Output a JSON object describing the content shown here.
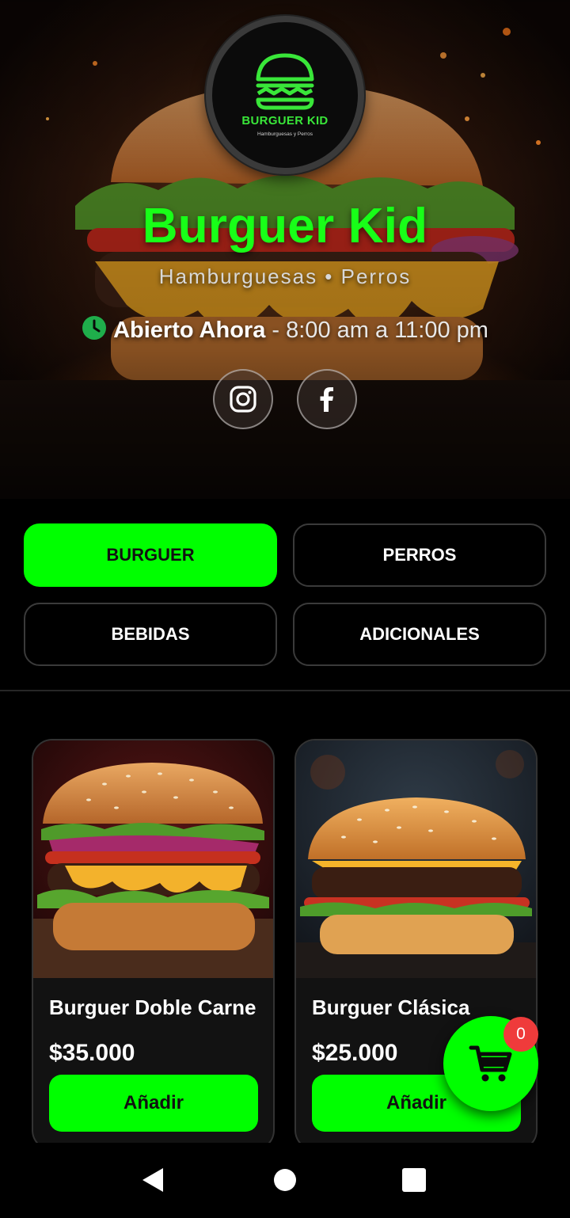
{
  "header": {
    "logo_title": "BURGUER KID",
    "logo_subtitle": "Hamburguesas y Perros",
    "shop_name": "Burguer Kid",
    "shop_subtitle": "Hamburguesas • Perros",
    "status": "Abierto Ahora",
    "status_separator": " - ",
    "hours_range": "8:00 am a 11:00 pm",
    "social": [
      {
        "name": "instagram",
        "icon": "instagram-icon"
      },
      {
        "name": "facebook",
        "icon": "facebook-icon"
      }
    ]
  },
  "categories": [
    {
      "label": "BURGUER",
      "active": true
    },
    {
      "label": "PERROS",
      "active": false
    },
    {
      "label": "BEBIDAS",
      "active": false
    },
    {
      "label": "ADICIONALES",
      "active": false
    }
  ],
  "products": [
    {
      "name": "Burguer Doble Carne",
      "price": "$35.000",
      "button": "Añadir"
    },
    {
      "name": "Burguer Clásica",
      "price": "$25.000",
      "button": "Añadir"
    }
  ],
  "cart": {
    "count": "0",
    "icon": "cart-icon"
  },
  "nav": {
    "icons": [
      "back-icon",
      "home-icon",
      "recents-icon"
    ]
  },
  "colors": {
    "accent": "#00ff00",
    "brand_title": "#18ff18",
    "background": "#000000",
    "badge": "#ef3b3b",
    "clock": "#1fae4b"
  }
}
